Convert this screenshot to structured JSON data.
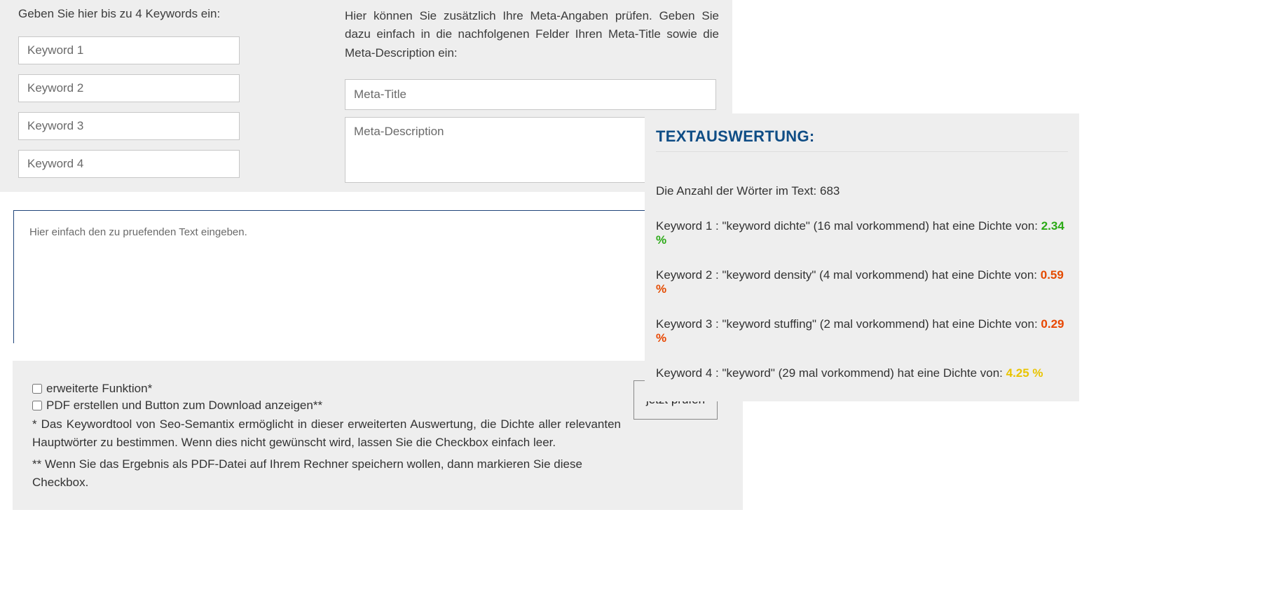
{
  "keywords_section": {
    "label": "Geben Sie hier bis zu 4 Keywords ein:",
    "placeholders": [
      "Keyword 1",
      "Keyword 2",
      "Keyword 3",
      "Keyword 4"
    ]
  },
  "meta_section": {
    "instruction": "Hier können Sie zusätzlich Ihre Meta-Angaben prüfen. Geben Sie dazu einfach in die nachfolgenen Felder Ihren Meta-Title sowie die Meta-Description ein:",
    "title_placeholder": "Meta-Title",
    "desc_placeholder": "Meta-Description"
  },
  "main_text": {
    "placeholder": "Hier einfach den zu pruefenden Text eingeben."
  },
  "results": {
    "heading": "TEXTAUSWERTUNG:",
    "wordcount_label_prefix": "Die Anzahl der Wörter im Text: ",
    "wordcount": "683",
    "rows": [
      {
        "text": "Keyword 1 : \"keyword dichte\" (16 mal vorkommend) hat eine Dichte von: ",
        "pct": "2.34 %",
        "class": "c-green"
      },
      {
        "text": "Keyword 2 : \"keyword density\" (4 mal vorkommend) hat eine Dichte von: ",
        "pct": "0.59 %",
        "class": "c-darkorange"
      },
      {
        "text": "Keyword 3 : \"keyword stuffing\" (2 mal vorkommend) hat eine Dichte von: ",
        "pct": "0.29 %",
        "class": "c-orangered"
      },
      {
        "text": "Keyword 4 : \"keyword\" (29 mal vorkommend) hat eine Dichte von: ",
        "pct": "4.25 %",
        "class": "c-yellow"
      }
    ]
  },
  "options": {
    "extended_label": "erweiterte Funktion*",
    "pdf_label": "PDF erstellen und Button zum Download anzeigen**",
    "footnote1": "* Das Keywordtool von Seo-Semantix ermöglicht in dieser erweiterten Auswertung, die Dichte aller relevanten Hauptwörter zu bestimmen. Wenn dies nicht gewünscht wird, lassen Sie die Checkbox einfach leer.",
    "footnote2": "** Wenn Sie das Ergebnis als PDF-Datei auf Ihrem Rechner speichern wollen, dann markieren Sie diese Checkbox."
  },
  "buttons": {
    "check": "jetzt prüfen"
  }
}
